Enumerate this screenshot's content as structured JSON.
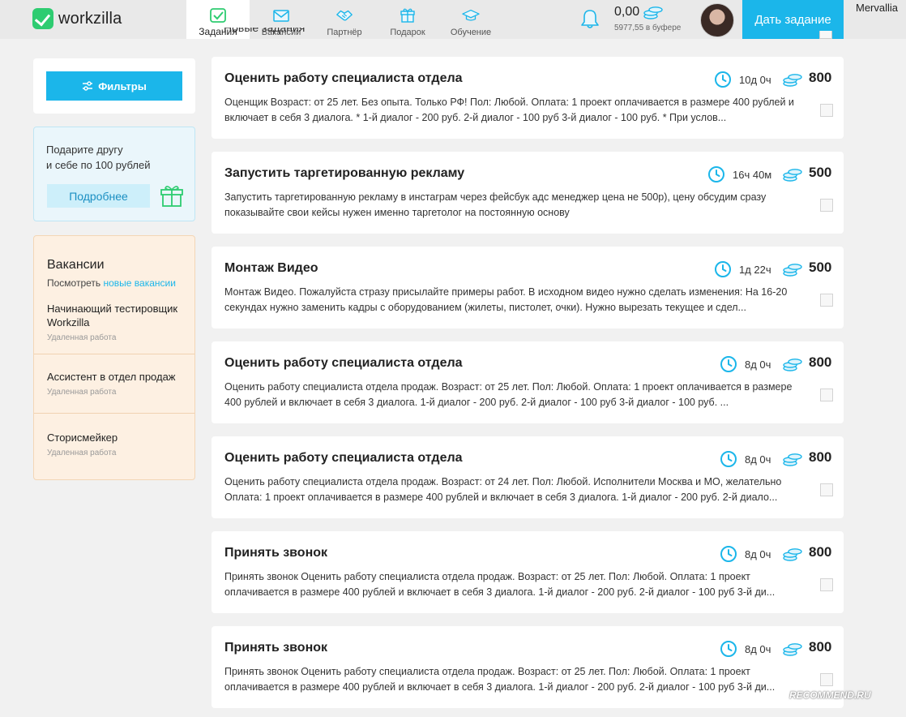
{
  "app": {
    "logo_text": "workzilla"
  },
  "nav": [
    {
      "label": "Задания",
      "icon": "tasks-check-icon",
      "active": true
    },
    {
      "label": "Вакансии",
      "icon": "envelope-icon",
      "active": false
    },
    {
      "label": "Партнёр",
      "icon": "handshake-icon",
      "active": false
    },
    {
      "label": "Подарок",
      "icon": "gift-icon",
      "active": false
    },
    {
      "label": "Обучение",
      "icon": "graduation-cap-icon",
      "active": false
    }
  ],
  "header": {
    "balance": "0,00",
    "buffer": "5977,55 в буфере",
    "cta_label": "Дать задание",
    "username": "Mervallia"
  },
  "sidebar": {
    "filter_label": "Фильтры",
    "gift": {
      "line1": "Подарите другу",
      "line2": "и себе по 100 рублей",
      "button_label": "Подробнее"
    },
    "vacancies": {
      "title": "Вакансии",
      "subtitle_prefix": "Посмотреть",
      "subtitle_link": "новые вакансии",
      "items": [
        {
          "title": "Начинающий тестировщик Workzilla",
          "meta": "Удаленная работа"
        },
        {
          "title": "Ассистент в отдел продаж",
          "meta": "Удаленная работа"
        },
        {
          "title": "Сторисмейкер",
          "meta": "Удаленная работа"
        }
      ]
    }
  },
  "tasks_header": "Новые задания",
  "tasks": [
    {
      "title": "Оценить работу специалиста отдела",
      "description": "Оценщик Возраст: от 25 лет. Без опыта. Только РФ! Пол: Любой. Оплата: 1 проект оплачивается в размере 400 рублей и включает в себя 3 диалога. * 1-й диалог - 200 руб. 2-й диалог - 100 руб 3-й диалог - 100 руб. * При услов...",
      "time": "10д 0ч",
      "price": "800"
    },
    {
      "title": "Запустить таргетированную рекламу",
      "description": "Запустить таргетированную рекламу в инстаграм через фейсбук адс менеджер цена не 500р), цену обсудим сразу показывайте свои кейсы нужен именно таргетолог на постоянную основу",
      "time": "16ч 40м",
      "price": "500"
    },
    {
      "title": "Монтаж Видео",
      "description": "Монтаж Видео. Пожалуйста стразу присылайте примеры работ. В исходном видео нужно сделать изменения: На 16-20 секундах нужно заменить кадры с оборудованием (жилеты, пистолет, очки). Нужно вырезать текущее и сдел...",
      "time": "1д 22ч",
      "price": "500"
    },
    {
      "title": "Оценить работу специалиста отдела",
      "description": "Оценить работу специалиста отдела продаж. Возраст: от 25 лет. Пол: Любой. Оплата: 1 проект оплачивается в размере 400 рублей и включает в себя 3 диалога. 1-й диалог - 200 руб. 2-й диалог - 100 руб 3-й диалог - 100 руб. ...",
      "time": "8д 0ч",
      "price": "800"
    },
    {
      "title": "Оценить работу специалиста отдела",
      "description": "Оценить работу специалиста отдела продаж. Возраст: от 24 лет. Пол: Любой. Исполнители Москва и МО, желательно Оплата: 1 проект оплачивается в размере 400 рублей и включает в себя 3 диалога. 1-й диалог - 200 руб. 2-й диало...",
      "time": "8д 0ч",
      "price": "800"
    },
    {
      "title": "Принять звонок",
      "description": "Принять звонок Оценить работу специалиста отдела продаж. Возраст: от 25 лет. Пол: Любой. Оплата: 1 проект оплачивается в размере 400 рублей и включает в себя 3 диалога. 1-й диалог - 200 руб. 2-й диалог - 100 руб 3-й ди...",
      "time": "8д 0ч",
      "price": "800"
    },
    {
      "title": "Принять звонок",
      "description": "Принять звонок Оценить работу специалиста отдела продаж. Возраст: от 25 лет. Пол: Любой. Оплата: 1 проект оплачивается в размере 400 рублей и включает в себя 3 диалога. 1-й диалог - 200 руб. 2-й диалог - 100 руб 3-й ди...",
      "time": "8д 0ч",
      "price": "800"
    }
  ],
  "watermark": "RECOMMEND.RU",
  "colors": {
    "accent": "#1bb6ea",
    "brand_green": "#2ecc71",
    "gift_bg": "#eaf6fb",
    "vacancy_bg": "#fdf0e2"
  }
}
